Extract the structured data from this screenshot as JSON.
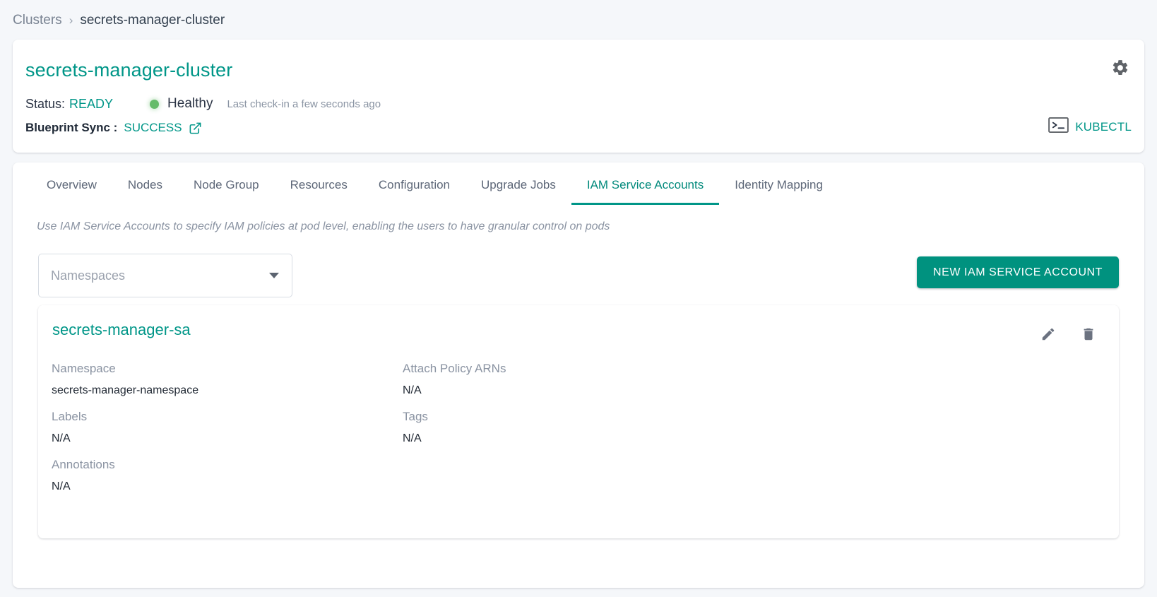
{
  "breadcrumb": {
    "root": "Clusters",
    "separator": "›",
    "current": "secrets-manager-cluster"
  },
  "header": {
    "title": "secrets-manager-cluster",
    "status_label": "Status:",
    "status_value": "READY",
    "health_text": "Healthy",
    "health_dot_color": "#66bb6a",
    "checkin_text": "Last check-in a few seconds ago",
    "sync_label": "Blueprint Sync :",
    "sync_value": "SUCCESS",
    "sync_link_icon": "external-link-icon",
    "settings_icon": "gear-icon",
    "kubectl_icon": "terminal-icon",
    "kubectl_label": "KUBECTL"
  },
  "tabs": [
    {
      "label": "Overview",
      "active": false
    },
    {
      "label": "Nodes",
      "active": false
    },
    {
      "label": "Node Group",
      "active": false
    },
    {
      "label": "Resources",
      "active": false
    },
    {
      "label": "Configuration",
      "active": false
    },
    {
      "label": "Upgrade Jobs",
      "active": false
    },
    {
      "label": "IAM Service Accounts",
      "active": true
    },
    {
      "label": "Identity Mapping",
      "active": false
    }
  ],
  "main": {
    "description": "Use IAM Service Accounts to specify IAM policies at pod level, enabling the users to have granular control on pods",
    "namespace_select": {
      "placeholder": "Namespaces",
      "value": "",
      "caret_icon": "chevron-down-icon"
    },
    "new_account_button": "NEW IAM SERVICE ACCOUNT"
  },
  "service_account": {
    "name": "secrets-manager-sa",
    "edit_icon": "pencil-icon",
    "delete_icon": "trash-icon",
    "fields": {
      "namespace_label": "Namespace",
      "namespace_value": "secrets-manager-namespace",
      "policy_arns_label": "Attach Policy ARNs",
      "policy_arns_value": "N/A",
      "labels_label": "Labels",
      "labels_value": "N/A",
      "tags_label": "Tags",
      "tags_value": "N/A",
      "annotations_label": "Annotations",
      "annotations_value": "N/A"
    }
  },
  "colors": {
    "accent": "#009688",
    "button": "#00927f",
    "healthy": "#66bb6a",
    "page_bg": "#f5f7fa"
  }
}
